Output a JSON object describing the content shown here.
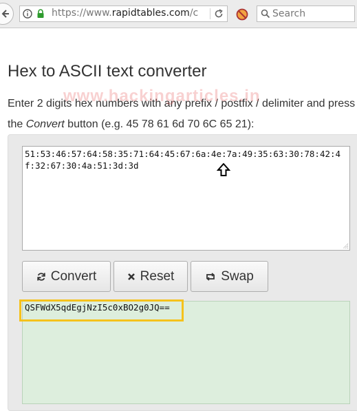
{
  "browser": {
    "url_prefix": "https://www.",
    "url_host": "rapidtables.com",
    "url_suffix": "/c",
    "search_placeholder": "Search"
  },
  "page": {
    "title": "Hex to ASCII text converter",
    "instructions_line1": "Enter 2 digits hex numbers with any prefix / postfix / delimiter and press",
    "instructions_the": "the ",
    "instructions_convert_word": "Convert",
    "instructions_line2_rest": " button (e.g. 45 78 61 6d 70 6C 65 21):",
    "watermark": "www.hackingarticles.in"
  },
  "converter": {
    "hex_input_value": "51:53:46:57:64:58:35:71:64:45:67:6a:4e:7a:49:35:63:30:78:42:4f:32:67:30:4a:51:3d:3d",
    "convert_label": "Convert",
    "reset_label": "Reset",
    "swap_label": "Swap",
    "output_text": "QSFWdX5qdEgjNzI5c0xBO2g0JQ=="
  },
  "colors": {
    "output_bg": "#ddeedd",
    "highlight_border": "#f5c21b",
    "watermark": "#e65a5a"
  }
}
